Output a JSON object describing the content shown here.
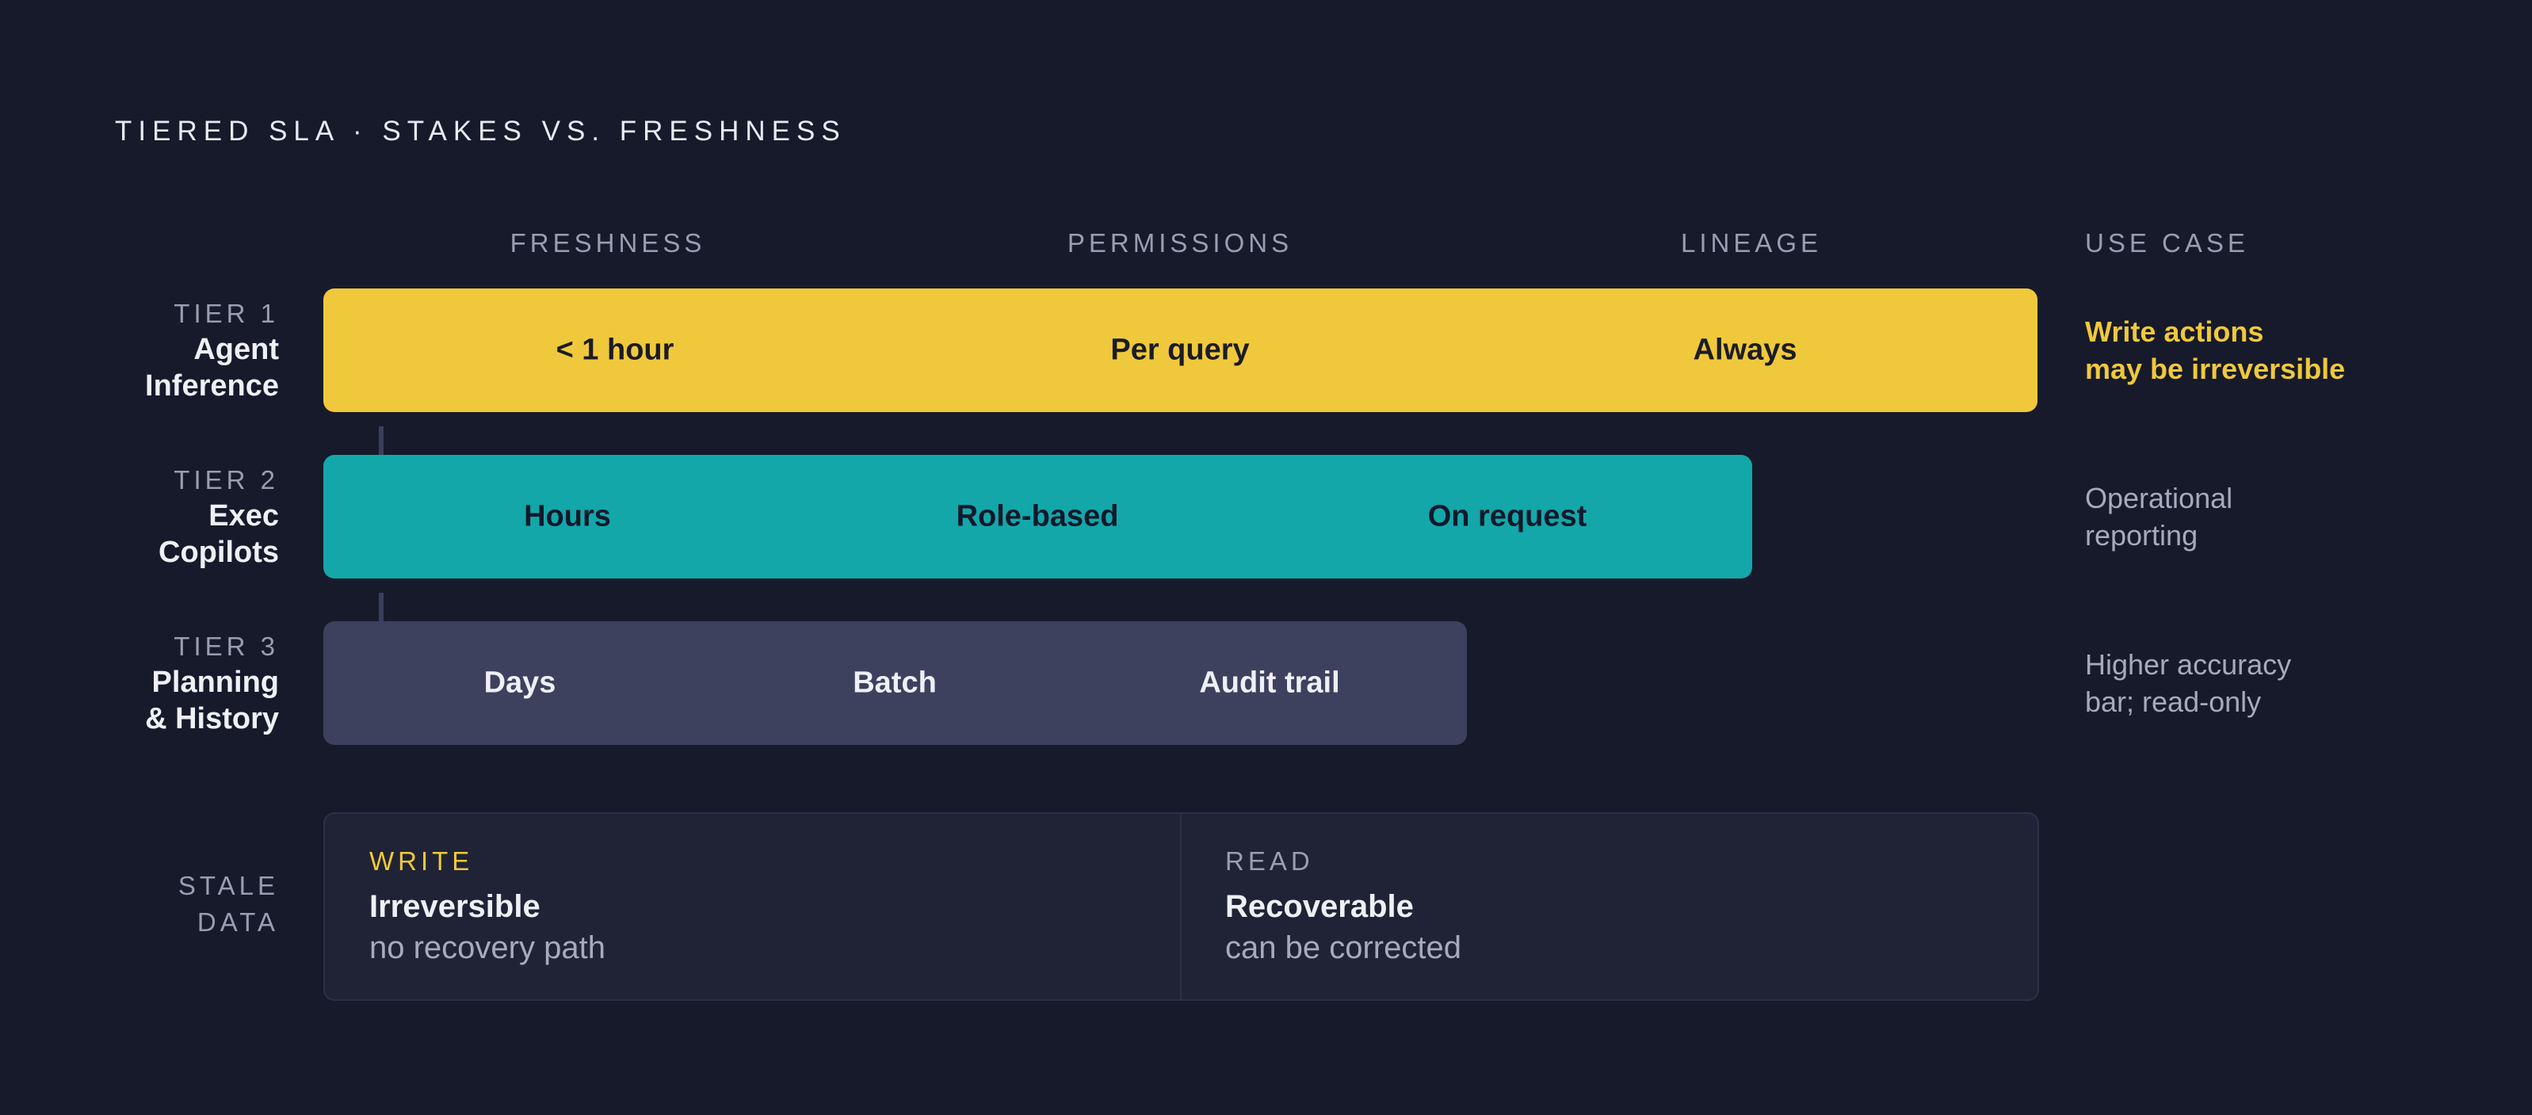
{
  "title": "TIERED SLA · STAKES VS. FRESHNESS",
  "columns": {
    "freshness": "FRESHNESS",
    "permissions": "PERMISSIONS",
    "lineage": "LINEAGE",
    "use_case": "USE CASE"
  },
  "tiers": [
    {
      "label": "TIER 1",
      "name_line1": "Agent",
      "name_line2": "Inference",
      "freshness": "< 1 hour",
      "permissions": "Per query",
      "lineage": "Always",
      "use_case_line1": "Write actions",
      "use_case_line2": "may be irreversible"
    },
    {
      "label": "TIER 2",
      "name_line1": "Exec",
      "name_line2": "Copilots",
      "freshness": "Hours",
      "permissions": "Role-based",
      "lineage": "On request",
      "use_case_line1": "Operational",
      "use_case_line2": "reporting"
    },
    {
      "label": "TIER 3",
      "name_line1": "Planning",
      "name_line2": "& History",
      "freshness": "Days",
      "permissions": "Batch",
      "lineage": "Audit trail",
      "use_case_line1": "Higher accuracy",
      "use_case_line2": "bar; read-only"
    }
  ],
  "stale_data": {
    "label_line1": "STALE",
    "label_line2": "DATA",
    "write": {
      "label": "WRITE",
      "title": "Irreversible",
      "desc": "no recovery path"
    },
    "read": {
      "label": "READ",
      "title": "Recoverable",
      "desc": "can be corrected"
    }
  },
  "colors": {
    "background": "#161a2b",
    "tier1": "#f0c83b",
    "tier2": "#13a7aa",
    "tier3": "#3d415e",
    "accent": "#f0c83b",
    "muted": "#9a9db2"
  }
}
